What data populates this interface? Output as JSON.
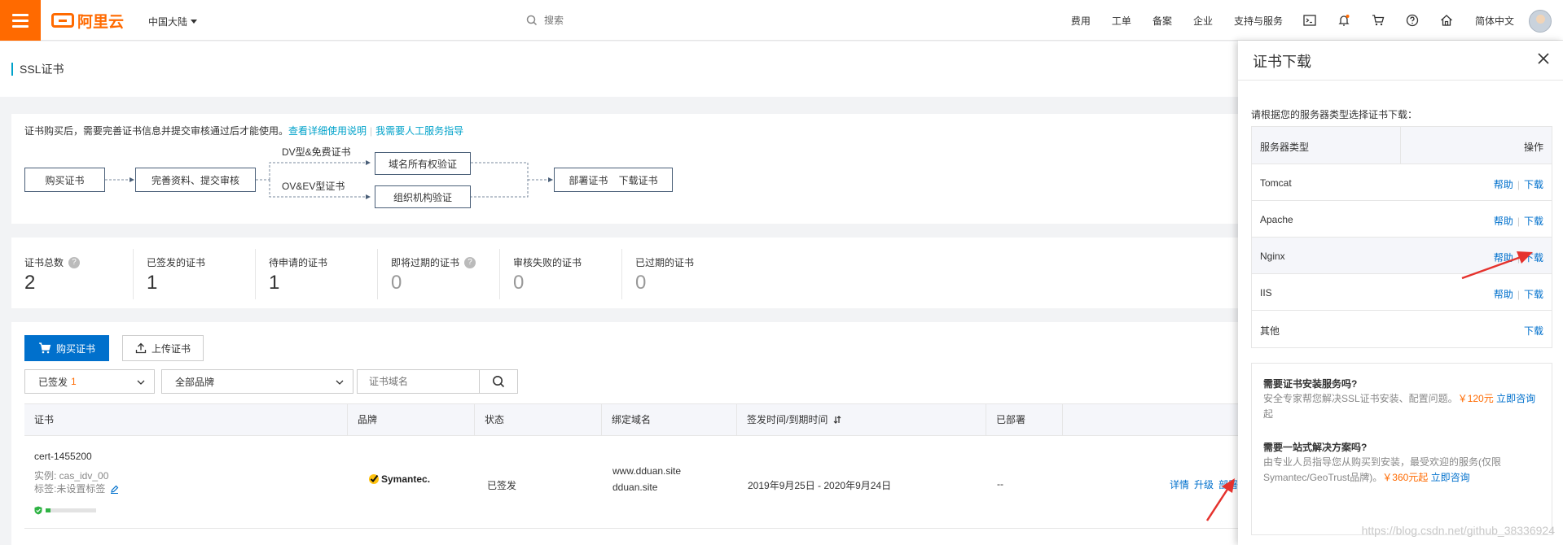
{
  "topbar": {
    "logo_text": "阿里云",
    "region": "中国大陆",
    "search_placeholder": "搜索",
    "nav": [
      "费用",
      "工单",
      "备案",
      "企业",
      "支持与服务"
    ],
    "language": "简体中文",
    "icons": [
      "terminal-icon",
      "bell-icon",
      "cart-icon",
      "help-icon",
      "home-icon"
    ]
  },
  "page": {
    "title": "SSL证书"
  },
  "flow": {
    "note": "证书购买后，需要完善证书信息并提交审核通过后才能使用。",
    "link1": "查看详细使用说明",
    "link2": "我需要人工服务指导",
    "boxes": [
      "购买证书",
      "完善资料、提交审核",
      "域名所有权验证",
      "组织机构验证",
      "部署证书    下载证书"
    ],
    "labels": [
      "DV型&免费证书",
      "OV&EV型证书"
    ]
  },
  "stats": [
    {
      "label": "证书总数",
      "value": "2",
      "help": true,
      "muted": false
    },
    {
      "label": "已签发的证书",
      "value": "1",
      "help": false,
      "muted": false
    },
    {
      "label": "待申请的证书",
      "value": "1",
      "help": false,
      "muted": false
    },
    {
      "label": "即将过期的证书",
      "value": "0",
      "help": true,
      "muted": true
    },
    {
      "label": "审核失败的证书",
      "value": "0",
      "help": false,
      "muted": true
    },
    {
      "label": "已过期的证书",
      "value": "0",
      "help": false,
      "muted": true
    }
  ],
  "list": {
    "buy_button": "购买证书",
    "upload_button": "上传证书",
    "status_select": {
      "value": "已签发",
      "count": "1"
    },
    "brand_select": {
      "value": "全部品牌"
    },
    "domain_placeholder": "证书域名",
    "columns": [
      "证书",
      "品牌",
      "状态",
      "绑定域名",
      "签发时间/到期时间",
      "已部署"
    ],
    "row": {
      "name": "cert-1455200",
      "instance": "实例: cas_idv_00",
      "tag": "标签:未设置标签",
      "progress": 0.1,
      "brand": "Symantec.",
      "status": "已签发",
      "domains": [
        "www.dduan.site",
        "dduan.site"
      ],
      "period": "2019年9月25日 - 2020年9月24日",
      "deployed": "--",
      "ops": [
        "详情",
        "升级",
        "部署"
      ]
    }
  },
  "drawer": {
    "title": "证书下载",
    "intro": "请根据您的服务器类型选择证书下载：",
    "col_server": "服务器类型",
    "col_action": "操作",
    "help_label": "帮助",
    "download_label": "下载",
    "servers": [
      {
        "name": "Tomcat",
        "help": true
      },
      {
        "name": "Apache",
        "help": true
      },
      {
        "name": "Nginx",
        "help": true
      },
      {
        "name": "IIS",
        "help": true
      },
      {
        "name": "其他",
        "help": false
      }
    ],
    "service1": {
      "title": "需要证书安装服务吗?",
      "desc": "安全专家帮您解决SSL证书安装、配置问题。",
      "price": "￥120元",
      "link": "立即咨询",
      "suffix": "起"
    },
    "service2": {
      "title": "需要一站式解决方案吗?",
      "desc": "由专业人员指导您从购买到安装，最受欢迎的服务(仅限Symantec/GeoTrust品牌)。",
      "price": "￥360元起",
      "link": "立即咨询"
    }
  },
  "watermark": "https://blog.csdn.net/github_38336924",
  "colors": {
    "brand": "#ff6a00",
    "link": "#0070cc",
    "arrow": "#e5322d"
  }
}
